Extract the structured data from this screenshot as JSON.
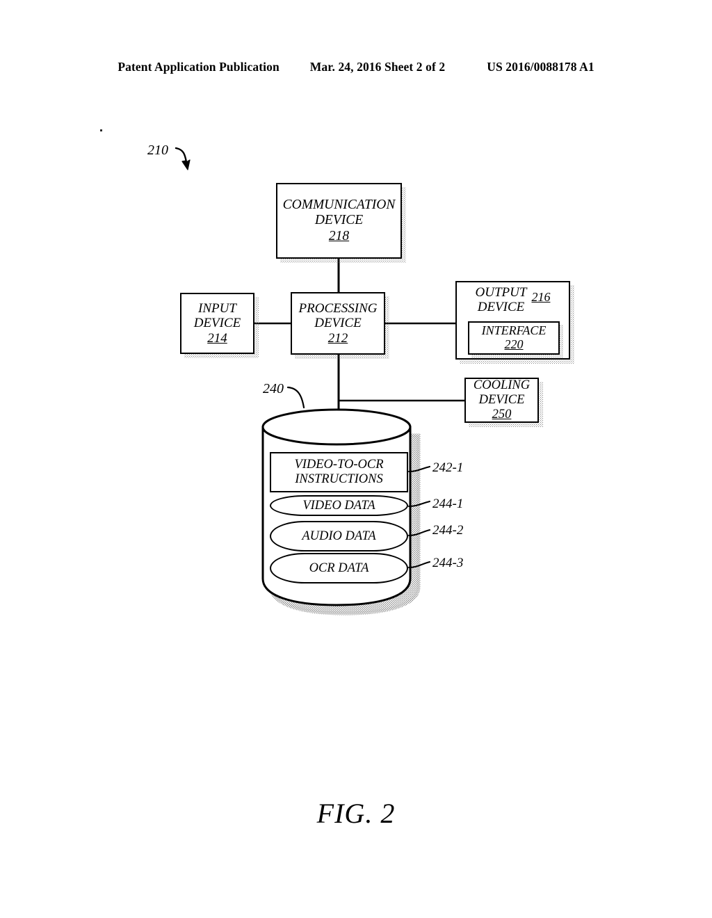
{
  "header": {
    "left": "Patent Application Publication",
    "middle": "Mar. 24, 2016  Sheet 2 of 2",
    "right": "US 2016/0088178 A1"
  },
  "figure": {
    "caption": "FIG. 2",
    "system_ref": "210",
    "storage_ref": "240"
  },
  "nodes": {
    "communication_device": {
      "line1": "COMMUNICATION",
      "line2": "DEVICE",
      "ref": "218"
    },
    "input_device": {
      "line1": "INPUT",
      "line2": "DEVICE",
      "ref": "214"
    },
    "processing_device": {
      "line1": "PROCESSING",
      "line2": "DEVICE",
      "ref": "212"
    },
    "output_device": {
      "line1": "OUTPUT",
      "line2": "DEVICE",
      "ref": "216",
      "interface": {
        "label": "INTERFACE",
        "ref": "220"
      }
    },
    "cooling_device": {
      "line1": "COOLING",
      "line2": "DEVICE",
      "ref": "250"
    }
  },
  "storage": {
    "items": [
      {
        "line1": "VIDEO-TO-OCR",
        "line2": "INSTRUCTIONS",
        "ref": "242-1"
      },
      {
        "line1": "VIDEO DATA",
        "line2": "",
        "ref": "244-1"
      },
      {
        "line1": "AUDIO DATA",
        "line2": "",
        "ref": "244-2"
      },
      {
        "line1": "OCR DATA",
        "line2": "",
        "ref": "244-3"
      }
    ]
  },
  "colors": {
    "ink": "#000000",
    "paper": "#ffffff",
    "shadow": "#7a7a7a"
  }
}
